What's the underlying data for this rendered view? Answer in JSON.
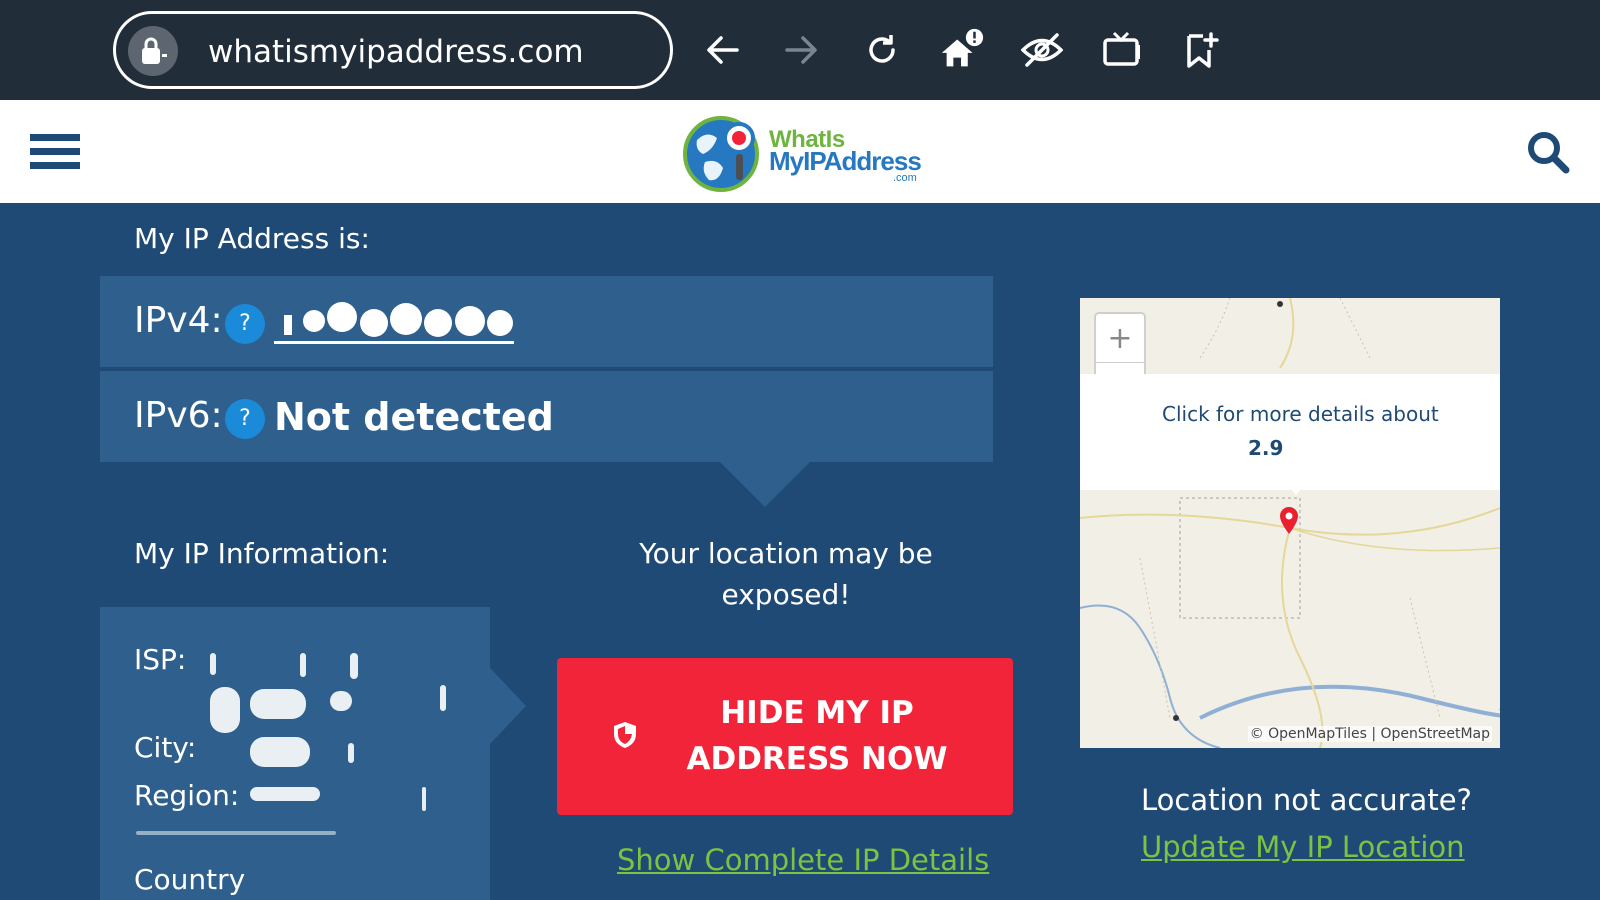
{
  "browser": {
    "url": "whatismyipaddress.com",
    "icons": [
      "lock-icon",
      "back-arrow-icon",
      "forward-arrow-icon",
      "reload-icon",
      "home-icon",
      "eye-off-icon",
      "tv-icon",
      "bookmark-add-icon"
    ]
  },
  "header": {
    "logo_line1": "WhatIs",
    "logo_line2": "MyIPAddress",
    "logo_suffix": ".com",
    "icons": [
      "menu-icon",
      "globe-logo-icon",
      "search-icon"
    ]
  },
  "ip": {
    "heading": "My IP Address is:",
    "ipv4_label": "IPv4:",
    "ipv6_label": "IPv6:",
    "help_glyph": "?",
    "ipv6_value": "Not detected"
  },
  "info": {
    "heading": "My IP Information:",
    "isp_label": "ISP:",
    "city_label": "City:",
    "region_label": "Region:",
    "country_label": "Country"
  },
  "cta": {
    "warning": "Your location may be exposed!",
    "hide_button": "HIDE MY IP ADDRESS NOW",
    "details_link": "Show Complete IP Details"
  },
  "map": {
    "popup_text": "Click for more details about",
    "popup_value": "2.9",
    "attribution": "© OpenMapTiles | OpenStreetMap",
    "zoom_in": "+",
    "zoom_out": "−"
  },
  "location": {
    "question": "Location not accurate?",
    "update_link": "Update My IP Location"
  },
  "colors": {
    "browser_bar": "#222d3a",
    "page_bg": "#1f4a75",
    "box_bg": "#2e5f8d",
    "cta_red": "#f1243a",
    "link_green": "#7dc242",
    "help_blue": "#1b8ad8"
  }
}
